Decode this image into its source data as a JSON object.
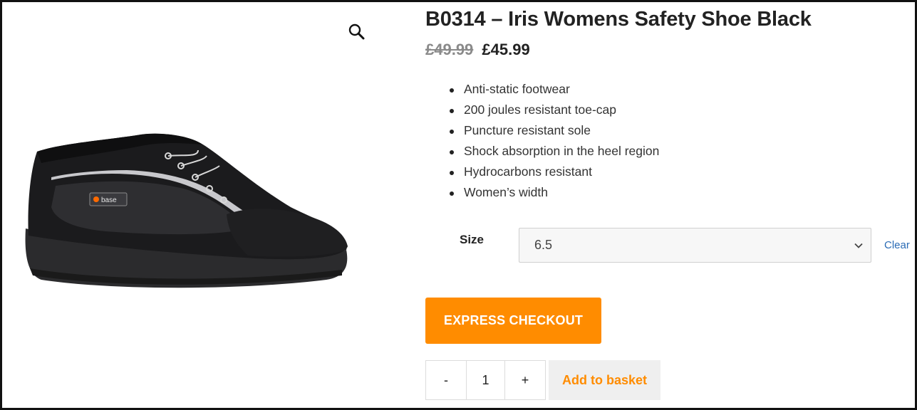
{
  "product": {
    "title": "B0314 – Iris Womens Safety Shoe Black",
    "price_old": "£49.99",
    "price_new": "£45.99",
    "image_brand_mark": "base",
    "features": [
      "Anti-static footwear",
      "200 joules resistant toe-cap",
      "Puncture resistant sole",
      "Shock absorption in the heel region",
      "Hydrocarbons resistant",
      "Women’s width"
    ]
  },
  "variation": {
    "size_label": "Size",
    "size_value": "6.5",
    "clear_label": "Clear"
  },
  "actions": {
    "express_label": "EXPRESS CHECKOUT",
    "qty_minus": "-",
    "qty_value": "1",
    "qty_plus": "+",
    "add_to_basket_label": "Add to basket"
  },
  "icons": {
    "zoom": "magnifier-icon",
    "select": "chevron-down-icon"
  },
  "colors": {
    "accent": "#ff8c00",
    "link": "#2a6bb5",
    "old_price": "#8a8a8a"
  }
}
